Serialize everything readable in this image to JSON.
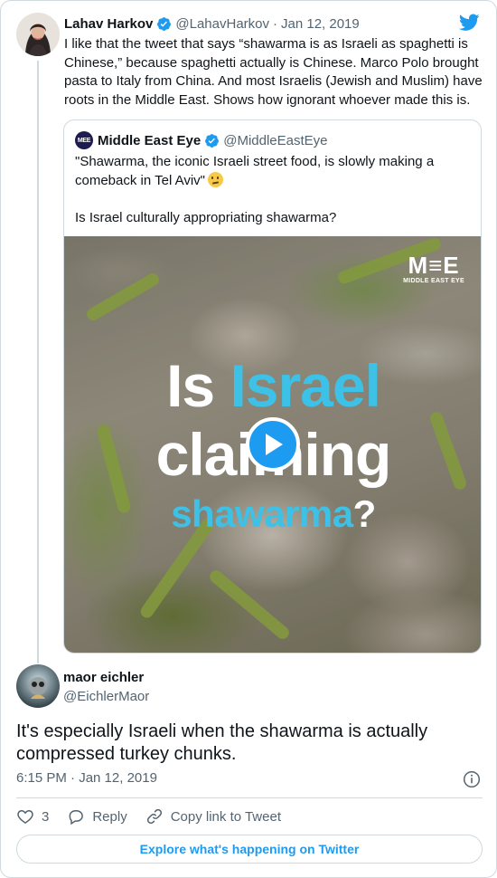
{
  "parent_tweet": {
    "author_name": "Lahav Harkov",
    "handle": "@LahavHarkov",
    "separator": "·",
    "date": "Jan 12, 2019",
    "text": "I like that the tweet that says “shawarma is as Israeli as spaghetti is Chinese,” because spaghetti actually is Chinese. Marco Polo brought pasta to Italy from China. And most Israelis (Jewish and Muslim) have roots in the Middle East. Shows how ignorant whoever made this is."
  },
  "quoted_tweet": {
    "avatar_text": "MEE",
    "author_name": "Middle East Eye",
    "handle": "@MiddleEastEye",
    "text_line1": "\"Shawarma, the iconic Israeli street food, is slowly making a comeback in Tel Aviv\"",
    "text_line2": "Is Israel culturally appropriating shawarma?",
    "video": {
      "logo_big": "M≡E",
      "logo_small": "MIDDLE EAST EYE",
      "title_is": "Is ",
      "title_israel": "Israel",
      "title_claiming": "claiming",
      "title_shawarma": "shawarma",
      "title_q": "?"
    }
  },
  "reply_tweet": {
    "author_name": "maor eichler",
    "handle": "@EichlerMaor",
    "text": "It's especially Israeli when the shawarma is actually compressed turkey chunks.",
    "timestamp": "6:15 PM · Jan 12, 2019"
  },
  "actions": {
    "like_count": "3",
    "reply_label": "Reply",
    "copy_link_label": "Copy link to Tweet"
  },
  "explore_label": "Explore what's happening on Twitter",
  "colors": {
    "twitter_blue": "#1d9bf0",
    "secondary_text": "#536471",
    "highlight_cyan": "#3ec1e6"
  },
  "icons": [
    "verified-badge-icon",
    "twitter-bird-icon",
    "play-icon",
    "info-icon",
    "heart-icon",
    "reply-bubble-icon",
    "link-icon"
  ]
}
